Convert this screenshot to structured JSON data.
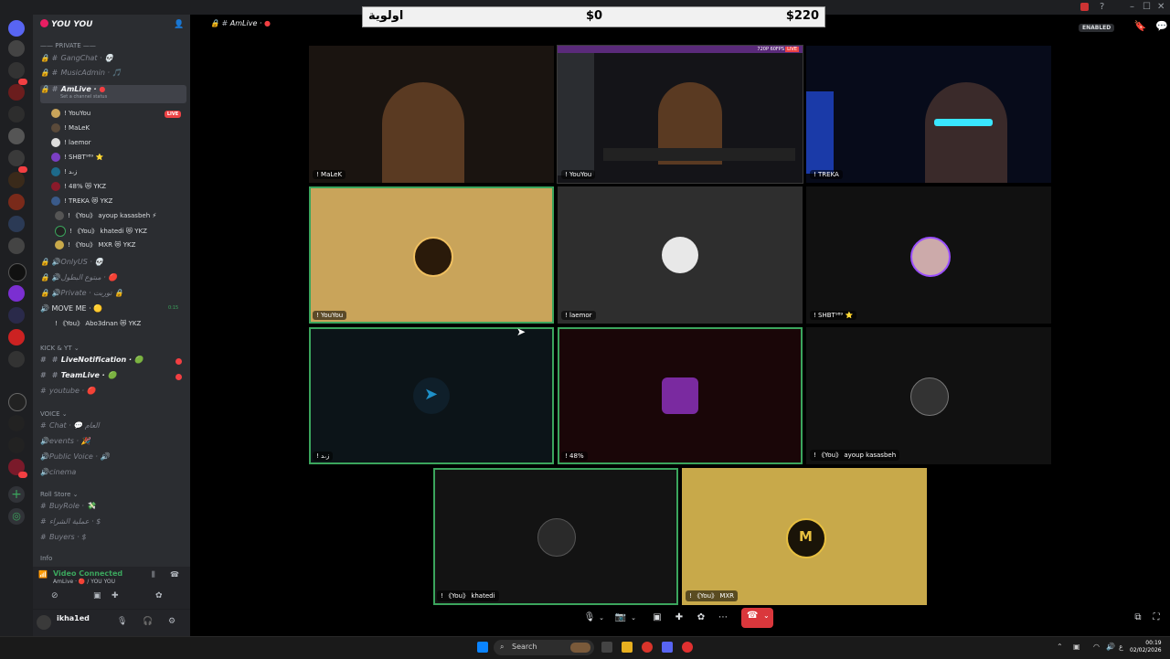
{
  "overlay": {
    "label": "اولوية",
    "left_amount": "$0",
    "right_amount": "$220"
  },
  "guild": {
    "name": "YOU YOU"
  },
  "sidebar": {
    "private_category": "PRIVATE",
    "channels_private": [
      {
        "name": "GangChat ·",
        "emoji": "💀"
      },
      {
        "name": "MusicAdmin ·",
        "emoji": "🎵"
      }
    ],
    "active_channel": {
      "name": "AmLive ·",
      "status": "Set a channel status"
    },
    "voice_users": [
      {
        "name": "! YouYou",
        "live": "LIVE"
      },
      {
        "name": "! MaLeK"
      },
      {
        "name": "! laemor"
      },
      {
        "name": "! SHBT⁹⁸⁹ ⭐"
      },
      {
        "name": "! ز،ﺪ"
      },
      {
        "name": "! 48% 😻 YKZ"
      },
      {
        "name": "! TREKA 😻 YKZ"
      },
      {
        "name": "! 《You》 ayoup kasasbeh ⚡"
      },
      {
        "name": "! 《You》 khatedi 😻 YKZ"
      },
      {
        "name": "! 《You》 MXR 😻 YKZ"
      }
    ],
    "more_channels": [
      {
        "name": "OnlyUS ·",
        "emoji": "💀"
      },
      {
        "name": "مبتوع البطول ·",
        "emoji": "🔴"
      },
      {
        "name": "Private · ﺗﻮﺭﺑﺖ",
        "emoji": "🔒"
      },
      {
        "name": "MOVE ME ·",
        "emoji": "🟡",
        "time": "0:15"
      }
    ],
    "move_me_user": "! 《You》 Abo3dnan 😻 YKZ",
    "kick_category": "KICK & YT",
    "kick_channels": [
      {
        "name": "LiveNotification ·",
        "emoji": "🟢"
      },
      {
        "name": "TeamLive ·",
        "emoji": "🟢"
      },
      {
        "name": "youtube ·",
        "emoji": "🔴"
      }
    ],
    "voice_category": "VOICE",
    "voice_channels": [
      {
        "name": "Chat ·",
        "emoji": "💬 العام"
      },
      {
        "name": "events ·",
        "emoji": "🎉"
      },
      {
        "name": "Public Voice ·",
        "emoji": "🔊"
      },
      {
        "name": "cinema",
        "emoji": ""
      }
    ],
    "roll_category": "Roll Store",
    "roll_channels": [
      {
        "name": "BuyRole ·",
        "emoji": "💸"
      },
      {
        "name": "عملية الشراء ·",
        "emoji": "$"
      },
      {
        "name": "Buyers ·",
        "emoji": "$"
      }
    ],
    "info_category": "Info"
  },
  "voice_panel": {
    "status": "Video Connected",
    "channel": "AmLive · 🔴 / YOU YOU"
  },
  "user_panel": {
    "username": "ikha1ed"
  },
  "header": {
    "channel": "AmLive ·",
    "enabled": "ENABLED"
  },
  "tiles": [
    {
      "label": "! MaLeK",
      "color": "#1a1410"
    },
    {
      "label": "! YouYou",
      "color": "#141418",
      "stream_badge": "720P 60FPS",
      "live": "LIVE"
    },
    {
      "label": "! TREKA",
      "color": "#070b1a"
    },
    {
      "label": "! YouYou",
      "color": "#c9a45a"
    },
    {
      "label": "! laemor",
      "color": "#2e2e2e"
    },
    {
      "label": "! SHBT⁹⁸⁹ ⭐",
      "color": "#111111"
    },
    {
      "label": "! ز،ﺪ",
      "color": "#0c1418"
    },
    {
      "label": "! 48%",
      "color": "#1a0608"
    },
    {
      "label": "! 《You》 ayoup kasasbeh",
      "color": "#111111"
    },
    {
      "label": "! 《You》 khatedi",
      "color": "#131313"
    },
    {
      "label": "! 《You》 MXR",
      "color": "#c8a94a"
    }
  ],
  "taskbar": {
    "search": "Search",
    "time": "00:19",
    "date": "02/02/2026"
  },
  "colors": {
    "accent_green": "#3ba55d",
    "hangup_red": "#da373c",
    "live_red": "#ed4245"
  }
}
